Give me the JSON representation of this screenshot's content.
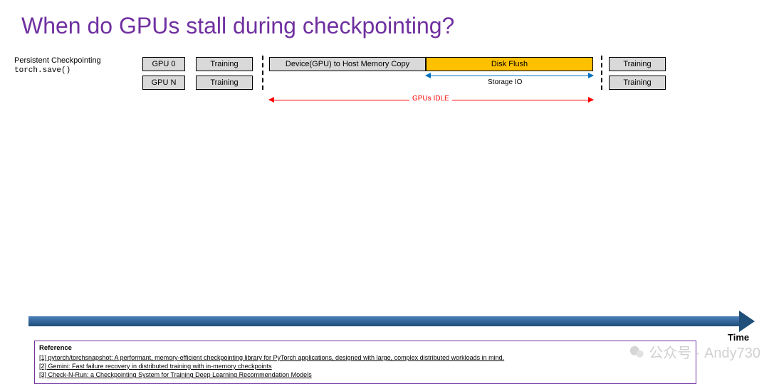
{
  "title": "When do GPUs stall during checkpointing?",
  "subtitle": {
    "line1": "Persistent Checkpointing",
    "line2": "torch.save()"
  },
  "row0": {
    "gpu": "GPU 0",
    "training1": "Training",
    "copy": "Device(GPU) to Host Memory Copy",
    "flush": "Disk Flush",
    "training2": "Training"
  },
  "rowN": {
    "gpu": "GPU N",
    "training1": "Training",
    "training2": "Training"
  },
  "io_label": "Storage IO",
  "idle_label": "GPUs IDLE",
  "time_label": "Time",
  "references": {
    "header": "Reference",
    "r1": "[1] pytorch/torchsnapshot: A performant, memory-efficient checkpointing library for PyTorch applications, designed with large, complex distributed workloads in mind.",
    "r2": "[2] Gemini: Fast failure recovery in distributed training with in-memory checkpoints",
    "r3": "[3] Check-N-Run: a Checkpointing System for Training Deep Learning Recommendation Models"
  },
  "watermark": "公众号 · Andy730",
  "chart_data": {
    "type": "timeline",
    "description": "Timeline showing GPU stall phases during persistent checkpointing via torch.save()",
    "rows": [
      {
        "id": "GPU 0",
        "segments": [
          "Training",
          "Device(GPU) to Host Memory Copy",
          "Disk Flush",
          "Training"
        ]
      },
      {
        "id": "GPU N",
        "segments": [
          "Training",
          "(idle during copy)",
          "(idle during flush)",
          "Training"
        ]
      }
    ],
    "annotations": [
      {
        "label": "Storage IO",
        "span": [
          "Disk Flush start",
          "Disk Flush end"
        ],
        "color": "#0070c0"
      },
      {
        "label": "GPUs IDLE",
        "span": [
          "Copy start",
          "Flush end"
        ],
        "color": "#ff0000"
      }
    ]
  }
}
